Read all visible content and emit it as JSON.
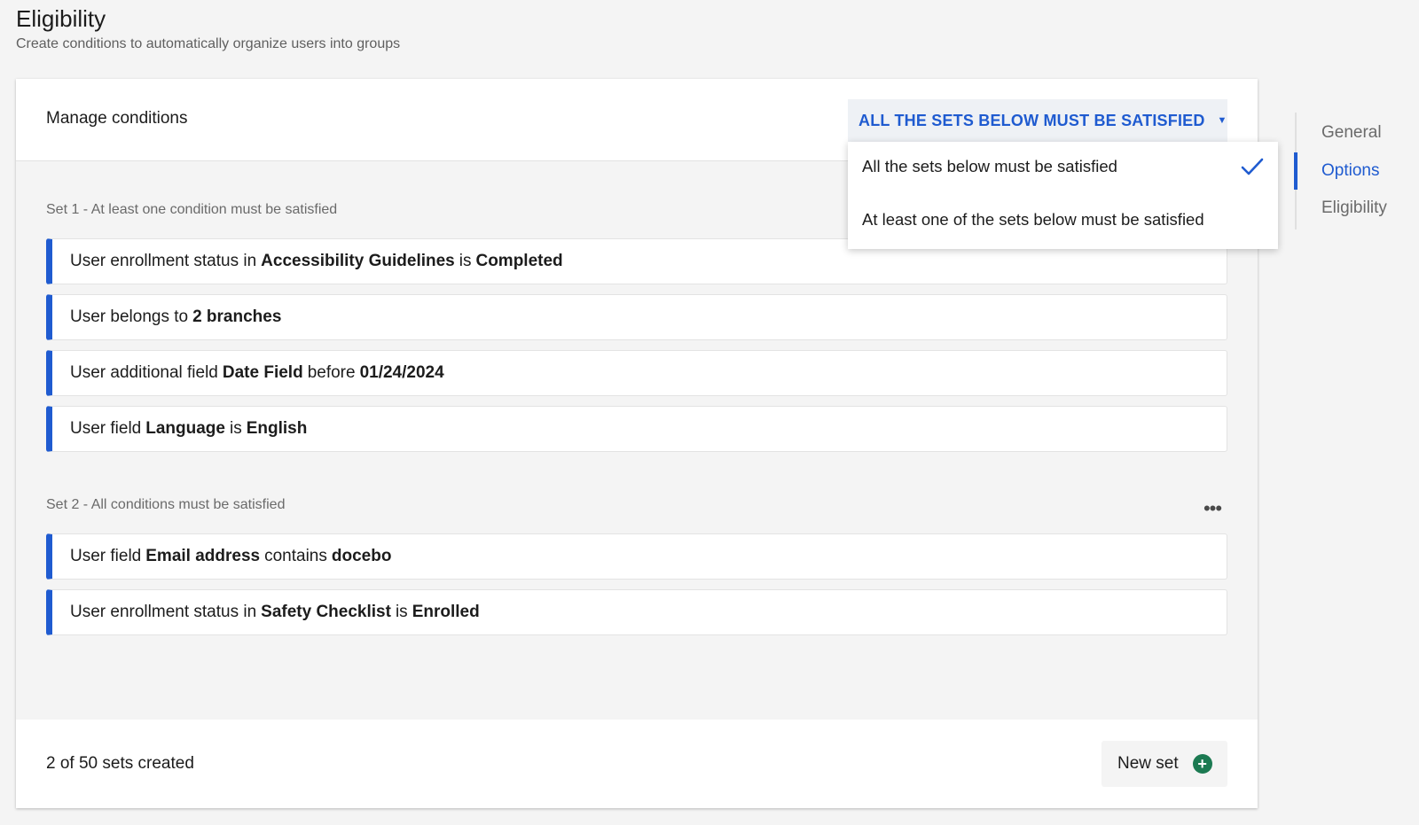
{
  "header": {
    "title": "Eligibility",
    "subtitle": "Create conditions to automatically organize users into groups"
  },
  "conditions_panel": {
    "title": "Manage conditions",
    "mode_select_value": "ALL THE SETS BELOW MUST BE SATISFIED",
    "mode_options": [
      {
        "label": "All the sets below must be satisfied",
        "selected": true
      },
      {
        "label": "At least one of the sets below must be satisfied",
        "selected": false
      }
    ],
    "sets": [
      {
        "label": "Set 1 - At least one condition must be satisfied",
        "conditions": [
          {
            "p1": "User enrollment status in",
            "b1": "Accessibility Guidelines",
            "p2": "is",
            "b2": "Completed"
          },
          {
            "p1": "User belongs to",
            "b1": "2 branches",
            "p2": "",
            "b2": ""
          },
          {
            "p1": "User additional field",
            "b1": "Date Field",
            "p2": "before",
            "b2": "01/24/2024"
          },
          {
            "p1": "User field",
            "b1": "Language",
            "p2": "is",
            "b2": "English"
          }
        ]
      },
      {
        "label": "Set 2 - All conditions must be satisfied",
        "conditions": [
          {
            "p1": "User field",
            "b1": "Email address",
            "p2": "contains",
            "b2": "docebo"
          },
          {
            "p1": "User enrollment status in",
            "b1": "Safety Checklist",
            "p2": "is",
            "b2": "Enrolled"
          }
        ]
      }
    ],
    "footer": {
      "count_text": "2 of 50 sets created",
      "new_set_label": "New set"
    }
  },
  "side_nav": {
    "items": [
      {
        "label": "General",
        "active": false
      },
      {
        "label": "Options",
        "active": true
      },
      {
        "label": "Eligibility",
        "active": false
      }
    ]
  },
  "colors": {
    "accent": "#1f5bd0",
    "add_icon": "#1c7a52",
    "background": "#f4f4f4"
  },
  "icons": {
    "mode_caret": "chevron-down-icon",
    "selected_check": "check-icon",
    "more": "more-horizontal-icon",
    "new_set": "plus-circle-icon"
  }
}
